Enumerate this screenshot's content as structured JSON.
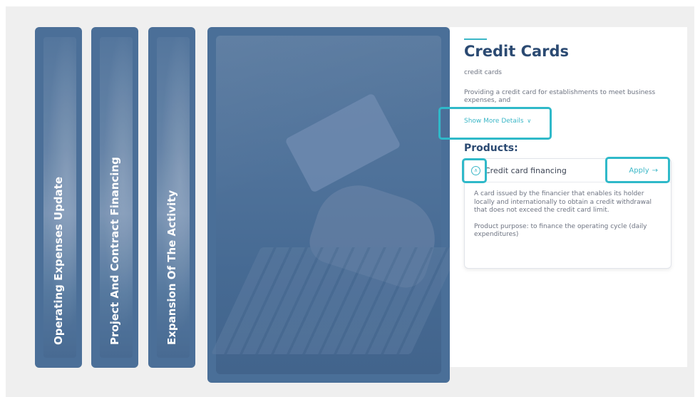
{
  "tabs": [
    {
      "label": "Operating Expenses Update"
    },
    {
      "label": "Project And Contract Financing"
    },
    {
      "label": "Expansion Of The Activity"
    }
  ],
  "detail": {
    "title": "Credit Cards",
    "subtitle": "credit cards",
    "description": "Providing a credit card for establishments to meet business expenses, and",
    "show_more_label": "Show More Details",
    "show_more_chevron": "∨",
    "products_heading": "Products:",
    "product": {
      "toggle_glyph": "∧",
      "name": "Credit card financing",
      "apply_label": "Apply",
      "apply_arrow": "→",
      "description": "A card issued by the financier that enables its holder locally and internationally to obtain a credit withdrawal that does not exceed the credit card limit.",
      "purpose": "Product purpose: to finance the operating cycle (daily expenditures)"
    }
  },
  "colors": {
    "accent": "#3bb7c7",
    "tab_bg": "#4b6f98",
    "title": "#2b4a72"
  }
}
